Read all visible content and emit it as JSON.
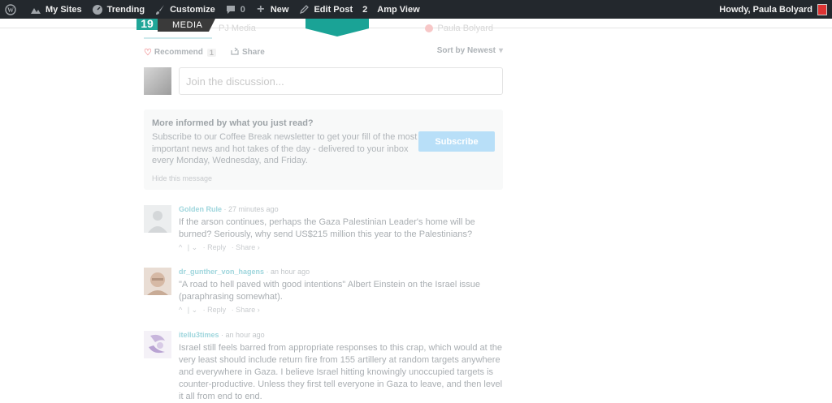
{
  "admin_bar": {
    "my_sites": "My Sites",
    "trending": "Trending",
    "customize": "Customize",
    "comments_count": "0",
    "new_label": "New",
    "edit_post": "Edit Post",
    "edit_post_count": "2",
    "amp_view": "Amp View",
    "howdy": "Howdy, Paula Bolyard"
  },
  "disqus_header": {
    "logo_number": "19",
    "logo_text": "MEDIA",
    "tab_left_faded": "PJ Media",
    "user_faded": "Paula Bolyard"
  },
  "toolbar": {
    "recommend_label": "Recommend",
    "recommend_count": "1",
    "share_label": "Share",
    "sort_label": "Sort by Newest",
    "sort_caret": "▾"
  },
  "composer": {
    "placeholder": "Join the discussion..."
  },
  "newsletter": {
    "title": "More informed by what you just read?",
    "body": "Subscribe to our Coffee Break newsletter to get your fill of the most important news and hot takes of the day - delivered to your inbox every Monday, Wednesday, and Friday.",
    "subscribe_label": "Subscribe",
    "hide_label": "Hide this message"
  },
  "comments": [
    {
      "author": "Golden Rule",
      "time": "· 27 minutes ago",
      "text": "If the arson continues, perhaps the Gaza Palestinian Leader's home will be burned? Seriously, why send US$215 million this year to the Palestinians?",
      "upvote": "^",
      "downvote": "| ⌄",
      "reply": "· Reply",
      "share": "· Share ›"
    },
    {
      "author": "dr_gunther_von_hagens",
      "time": "· an hour ago",
      "text": "\"A road to hell paved with good intentions\" Albert Einstein on the Israel issue (paraphrasing somewhat).",
      "upvote": "^",
      "downvote": "| ⌄",
      "reply": "· Reply",
      "share": "· Share ›"
    },
    {
      "author": "itellu3times",
      "time": "· an hour ago",
      "text": "Israel still feels barred from appropriate responses to this crap, which would at the very least should include return fire from 155 artillery at random targets anywhere and everywhere in Gaza. I believe Israel hitting knowingly unoccupied targets is counter-productive. Unless they first tell everyone in Gaza to leave, and then level it all from end to end."
    }
  ]
}
